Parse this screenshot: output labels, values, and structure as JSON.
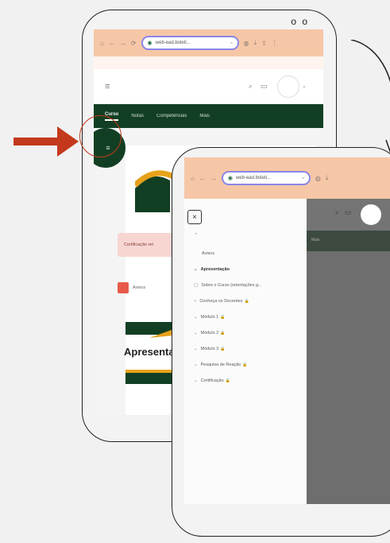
{
  "back_phone": {
    "dots": "o o",
    "browser": {
      "nav_icons": [
        "home-icon",
        "back-icon",
        "forward-icon",
        "refresh-icon"
      ],
      "url_text": "web-ead.boleti...",
      "actions": [
        "tab-count-icon",
        "share-icon",
        "download-icon",
        "more-icon"
      ]
    },
    "header_icons": [
      "menu-icon",
      "search-icon",
      "chat-icon",
      "avatar"
    ],
    "nav_tabs": [
      "Curso",
      "Notas",
      "Competências",
      "Mais"
    ],
    "alert_text": "Certificação ret",
    "course_item_label": "Avisos",
    "course_title": "Apresenta"
  },
  "front_phone": {
    "browser": {
      "url_text": "web-ead.boleti..."
    },
    "close_button": "×",
    "collapse_icon": "chevron-up-icon",
    "sidebar": {
      "home": "Avisos",
      "section": "Apresentação",
      "items": [
        {
          "label": "Sobre o Curso (orientações g...",
          "locked": false
        },
        {
          "label": "Conheça os Docentes",
          "locked": true
        },
        {
          "label": "Módulo 1",
          "locked": true
        },
        {
          "label": "Módulo 2",
          "locked": true
        },
        {
          "label": "Módulo 3",
          "locked": true
        },
        {
          "label": "Pesquisa de Reação",
          "locked": true
        },
        {
          "label": "Certificação",
          "locked": true
        }
      ]
    },
    "right_label": "Mais"
  },
  "colors": {
    "brand_green": "#123f23",
    "accent_red": "#c4391c",
    "browser_bar": "#f6c7a7"
  }
}
